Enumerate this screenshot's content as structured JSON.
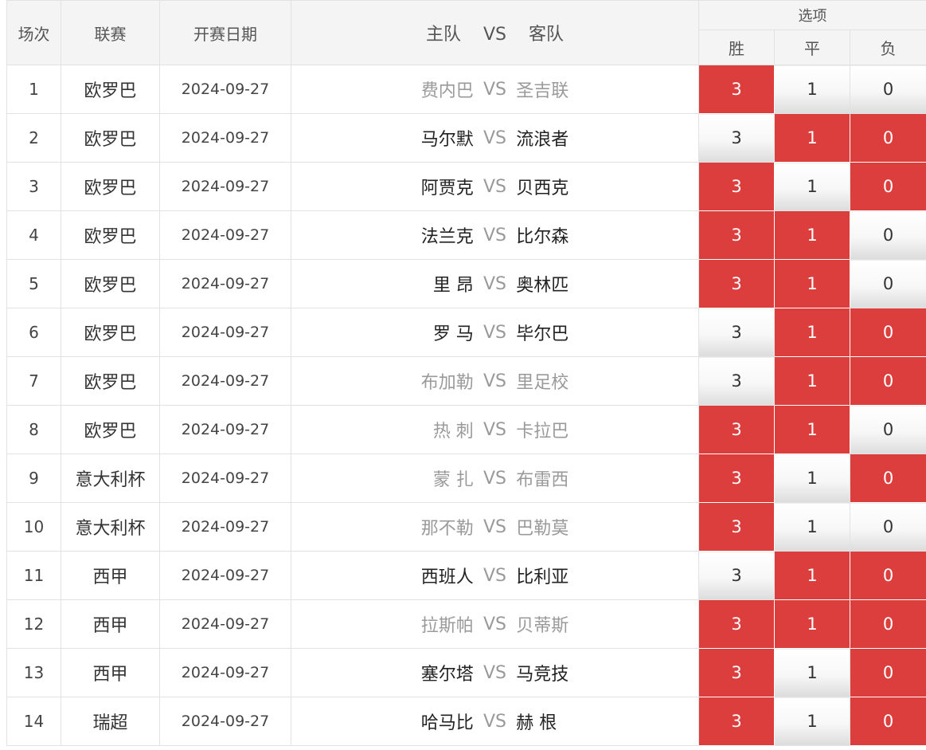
{
  "header": {
    "col_no": "场次",
    "col_league": "联赛",
    "col_date": "开赛日期",
    "col_match_home": "主队",
    "col_match_vs": "VS",
    "col_match_away": "客队",
    "col_options": "选项",
    "opt_win": "胜",
    "opt_draw": "平",
    "opt_lose": "负"
  },
  "colors": {
    "selected": "#dc3e3e",
    "dimmed_team": "#9a9a9a"
  },
  "vs_label": "VS",
  "matches": [
    {
      "no": "1",
      "league": "欧罗巴",
      "date": "2024-09-27",
      "home": "费内巴",
      "away": "圣吉联",
      "home_dim": true,
      "away_dim": true,
      "win": "3",
      "draw": "1",
      "lose": "0",
      "sel": [
        true,
        false,
        false
      ]
    },
    {
      "no": "2",
      "league": "欧罗巴",
      "date": "2024-09-27",
      "home": "马尔默",
      "away": "流浪者",
      "home_dim": false,
      "away_dim": false,
      "win": "3",
      "draw": "1",
      "lose": "0",
      "sel": [
        false,
        true,
        true
      ]
    },
    {
      "no": "3",
      "league": "欧罗巴",
      "date": "2024-09-27",
      "home": "阿贾克",
      "away": "贝西克",
      "home_dim": false,
      "away_dim": false,
      "win": "3",
      "draw": "1",
      "lose": "0",
      "sel": [
        true,
        false,
        true
      ]
    },
    {
      "no": "4",
      "league": "欧罗巴",
      "date": "2024-09-27",
      "home": "法兰克",
      "away": "比尔森",
      "home_dim": false,
      "away_dim": false,
      "win": "3",
      "draw": "1",
      "lose": "0",
      "sel": [
        true,
        true,
        false
      ]
    },
    {
      "no": "5",
      "league": "欧罗巴",
      "date": "2024-09-27",
      "home": "里 昂",
      "away": "奥林匹",
      "home_dim": false,
      "away_dim": false,
      "win": "3",
      "draw": "1",
      "lose": "0",
      "sel": [
        true,
        true,
        false
      ]
    },
    {
      "no": "6",
      "league": "欧罗巴",
      "date": "2024-09-27",
      "home": "罗 马",
      "away": "毕尔巴",
      "home_dim": false,
      "away_dim": false,
      "win": "3",
      "draw": "1",
      "lose": "0",
      "sel": [
        false,
        true,
        true
      ]
    },
    {
      "no": "7",
      "league": "欧罗巴",
      "date": "2024-09-27",
      "home": "布加勒",
      "away": "里足校",
      "home_dim": true,
      "away_dim": true,
      "win": "3",
      "draw": "1",
      "lose": "0",
      "sel": [
        false,
        true,
        true
      ]
    },
    {
      "no": "8",
      "league": "欧罗巴",
      "date": "2024-09-27",
      "home": "热 刺",
      "away": "卡拉巴",
      "home_dim": true,
      "away_dim": true,
      "win": "3",
      "draw": "1",
      "lose": "0",
      "sel": [
        true,
        true,
        false
      ]
    },
    {
      "no": "9",
      "league": "意大利杯",
      "date": "2024-09-27",
      "home": "蒙 扎",
      "away": "布雷西",
      "home_dim": true,
      "away_dim": true,
      "win": "3",
      "draw": "1",
      "lose": "0",
      "sel": [
        true,
        false,
        true
      ]
    },
    {
      "no": "10",
      "league": "意大利杯",
      "date": "2024-09-27",
      "home": "那不勒",
      "away": "巴勒莫",
      "home_dim": true,
      "away_dim": true,
      "win": "3",
      "draw": "1",
      "lose": "0",
      "sel": [
        true,
        false,
        false
      ]
    },
    {
      "no": "11",
      "league": "西甲",
      "date": "2024-09-27",
      "home": "西班人",
      "away": "比利亚",
      "home_dim": false,
      "away_dim": false,
      "win": "3",
      "draw": "1",
      "lose": "0",
      "sel": [
        false,
        true,
        true
      ]
    },
    {
      "no": "12",
      "league": "西甲",
      "date": "2024-09-27",
      "home": "拉斯帕",
      "away": "贝蒂斯",
      "home_dim": true,
      "away_dim": true,
      "win": "3",
      "draw": "1",
      "lose": "0",
      "sel": [
        true,
        true,
        true
      ]
    },
    {
      "no": "13",
      "league": "西甲",
      "date": "2024-09-27",
      "home": "塞尔塔",
      "away": "马竞技",
      "home_dim": false,
      "away_dim": false,
      "win": "3",
      "draw": "1",
      "lose": "0",
      "sel": [
        true,
        false,
        true
      ]
    },
    {
      "no": "14",
      "league": "瑞超",
      "date": "2024-09-27",
      "home": "哈马比",
      "away": "赫 根",
      "home_dim": false,
      "away_dim": false,
      "win": "3",
      "draw": "1",
      "lose": "0",
      "sel": [
        true,
        false,
        true
      ]
    }
  ]
}
